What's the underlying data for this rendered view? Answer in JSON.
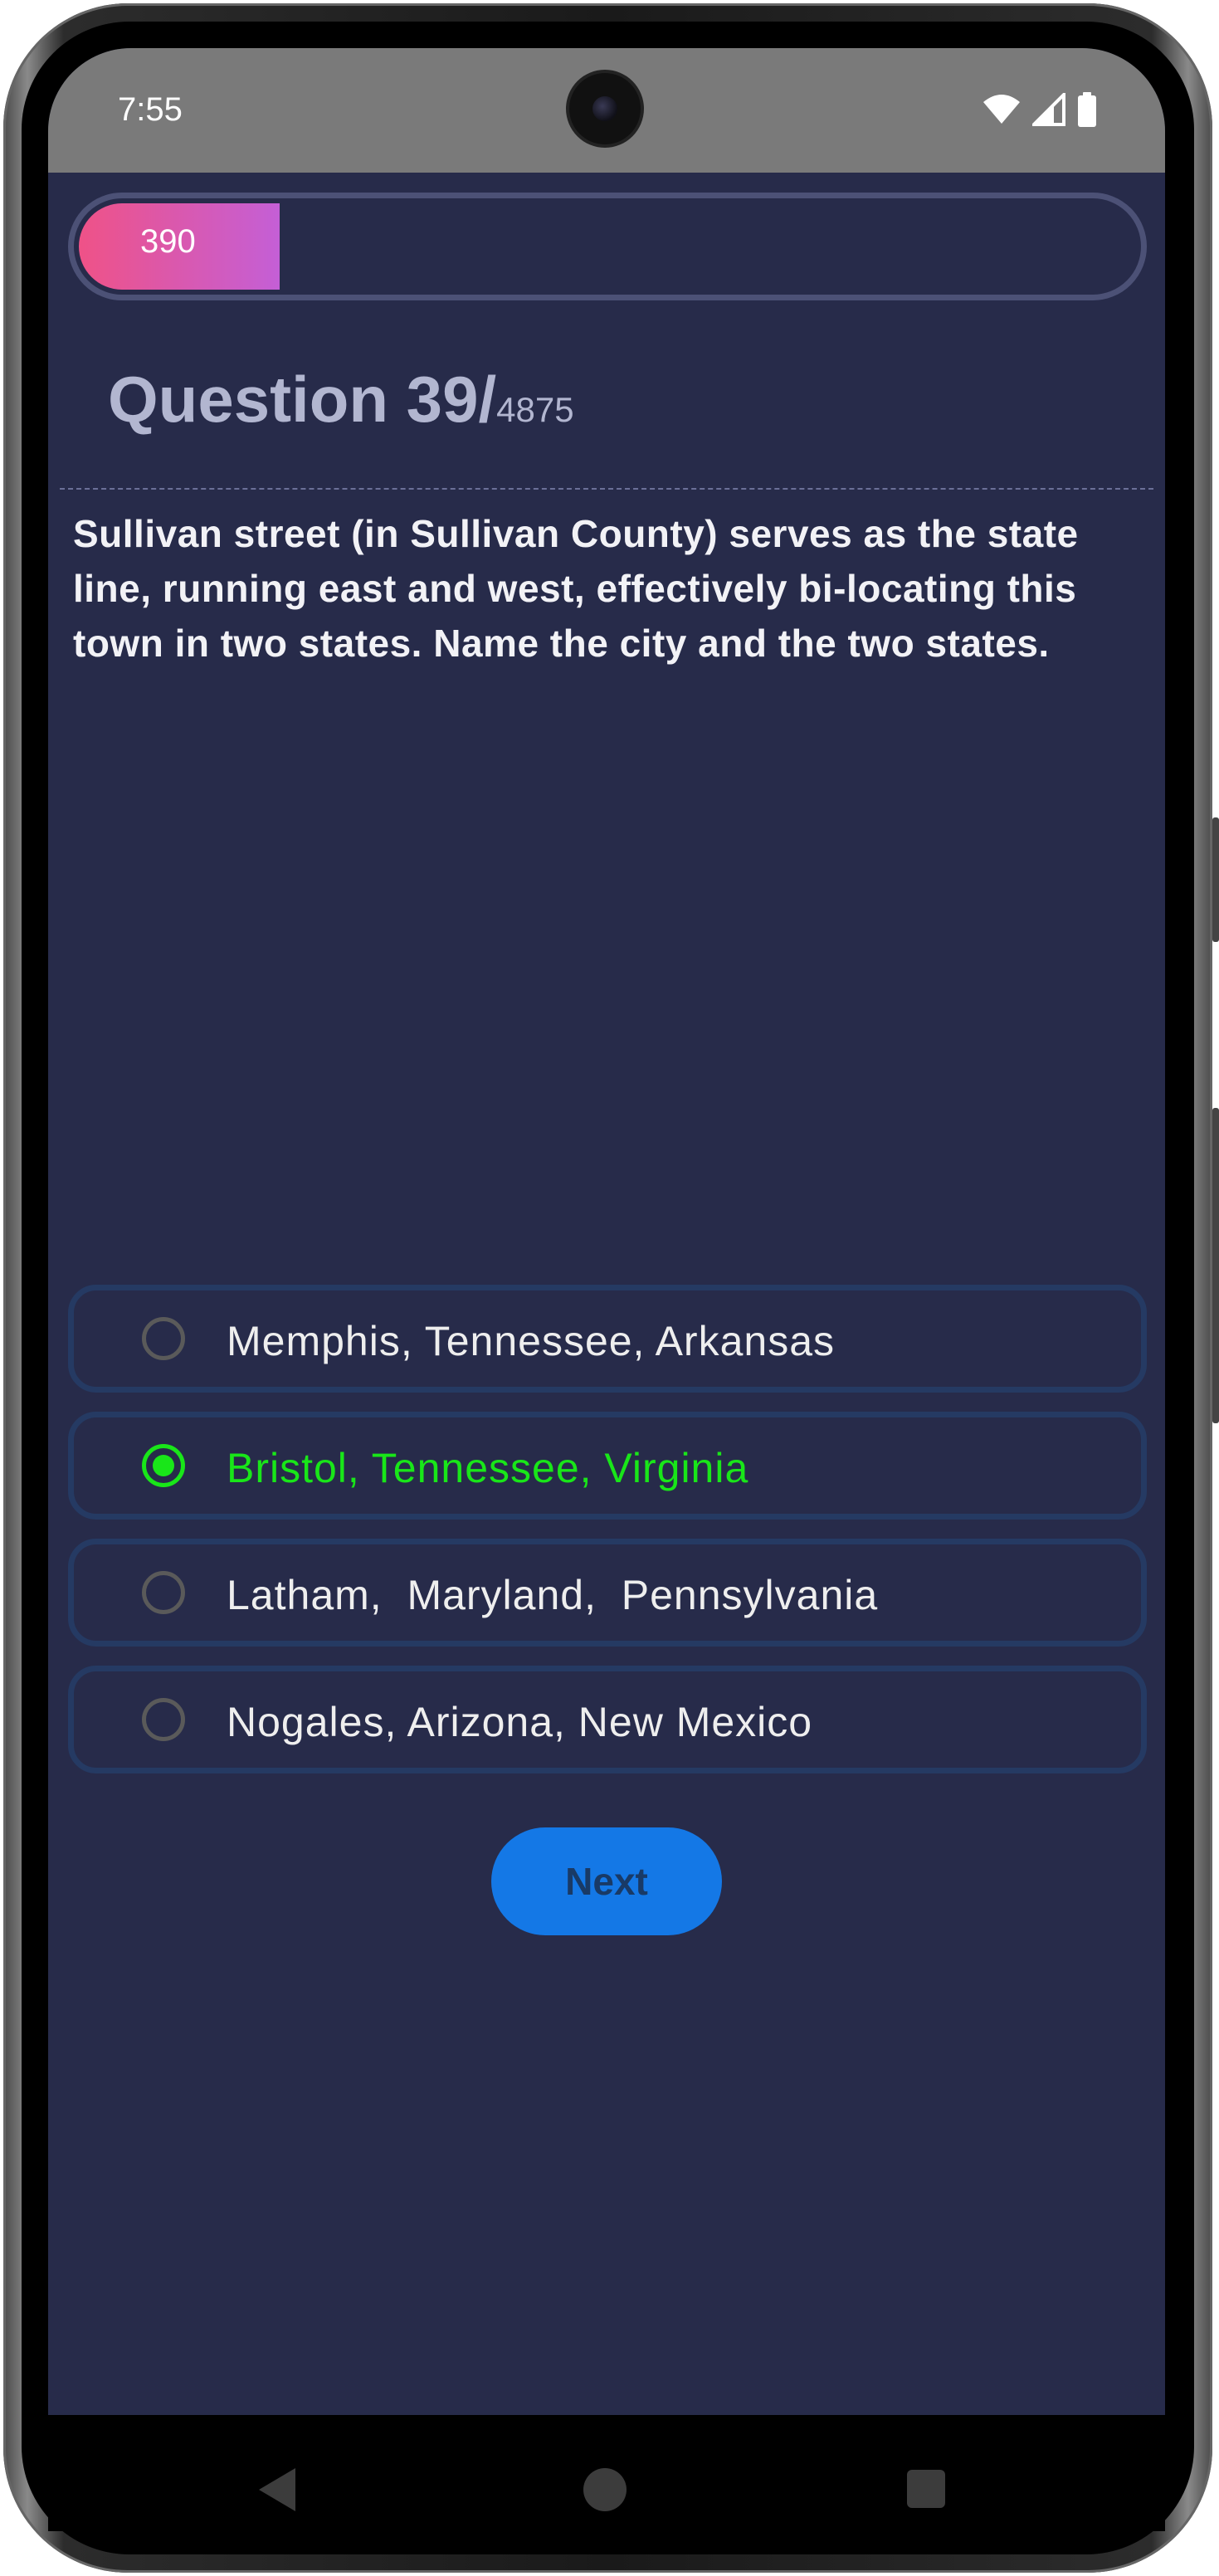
{
  "status_bar": {
    "time": "7:55",
    "icons": [
      "wifi-icon",
      "signal-icon",
      "battery-icon"
    ]
  },
  "progress": {
    "label": "390",
    "fraction": 0.19
  },
  "question": {
    "title": "Question 39/",
    "total": "4875",
    "text": "Sullivan street (in Sullivan County) serves as the state line, running east and west, effectively bi-locating this town in two states.  Name the city and the two states."
  },
  "options": [
    {
      "label": "Memphis, Tennessee, Arkansas",
      "selected": false
    },
    {
      "label": "Bristol, Tennessee, Virginia",
      "selected": true
    },
    {
      "label": "Latham,  Maryland,  Pennsylvania",
      "selected": false
    },
    {
      "label": "Nogales, Arizona, New Mexico",
      "selected": false
    }
  ],
  "next_button": {
    "label": "Next"
  },
  "colors": {
    "background": "#272b4a",
    "status_bar": "#7a7a7a",
    "progress_start": "#ef5287",
    "progress_end": "#c45fd6",
    "selected": "#19e619",
    "option_border": "#253a63",
    "button": "#1478e6"
  },
  "nav_bar": {
    "icons": [
      "back-icon",
      "home-icon",
      "recents-icon"
    ]
  }
}
